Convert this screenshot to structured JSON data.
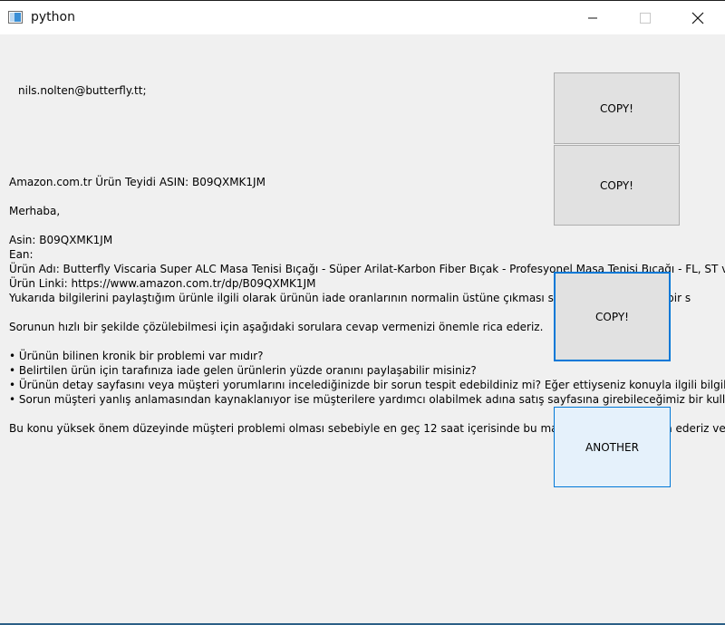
{
  "window": {
    "title": "python",
    "icon": "python-window-icon"
  },
  "email": "nils.nolten@butterfly.tt;",
  "message": {
    "text": "Amazon.com.tr Ürün Teyidi ASIN: B09QXMK1JM\n\nMerhaba,\n\nAsin: B09QXMK1JM\nEan:\nÜrün Adı: Butterfly Viscaria Super ALC Masa Tenisi Bıçağı - Süper Arilat-Karbon Fiber Bıçak - Profesyonel Masa Tenisi Bıçağı - FL, ST ve Çi\nÜrün Linki: https://www.amazon.com.tr/dp/B09QXMK1JM\nYukarıda bilgilerini paylaştığım ürünle ilgili olarak ürünün iade oranlarının normalin üstüne çıkması sebebiyle ürünle ilgili bir s\n\nSorunun hızlı bir şekilde çözülebilmesi için aşağıdaki sorulara cevap vermenizi önemle rica ederiz.\n\n• Ürünün bilinen kronik bir problemi var mıdır?\n• Belirtilen ürün için tarafınıza iade gelen ürünlerin yüzde oranını paylaşabilir misiniz?\n• Ürünün detay sayfasını veya müşteri yorumlarını incelediğinizde bir sorun tespit edebildiniz mi? Eğer ettiyseniz konuyla ilgili bilgilendirmer\n• Sorun müşteri yanlış anlamasından kaynaklanıyor ise müşterilere yardımcı olabilmek adına satış sayfasına girebileceğimiz bir kullanım tal\n\nBu konu yüksek önem düzeyinde müşteri problemi olması sebebiyle en geç 12 saat içerisinde bu maili cevaplamanızı rica ederiz ve bu konuda yardımcı olması rica ed"
  },
  "buttons": {
    "copy_email": "COPY!",
    "copy_subject": "COPY!",
    "copy_body": "COPY!",
    "another": "ANOTHER"
  },
  "colors": {
    "focus_border": "#0078d7",
    "hover_bg": "#e5f1fb",
    "button_bg": "#e1e1e1"
  }
}
